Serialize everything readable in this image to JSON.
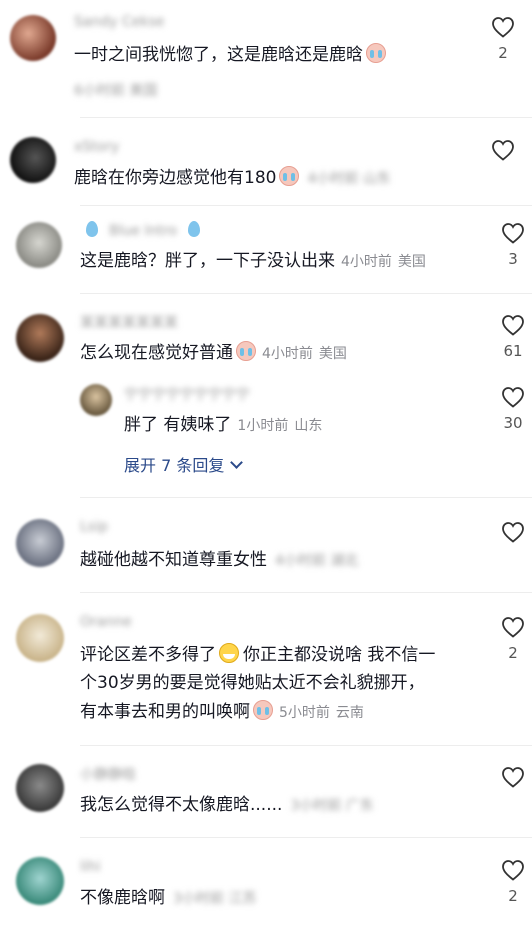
{
  "comments": [
    {
      "username": "Sandy Cekse",
      "text": "一时之间我恍惚了，这是鹿晗还是鹿晗",
      "meta_blurred": "6小时前 美国",
      "likes": "2"
    },
    {
      "username": "xStory",
      "text": "鹿晗在你旁边感觉他有180",
      "meta_blurred": "4小时前 山东",
      "likes": ""
    },
    {
      "username": "Blue Intro",
      "text": "这是鹿晗？胖了，一下子没认出来",
      "time": "4小时前",
      "location": "美国",
      "likes": "3"
    },
    {
      "username": "某某某某某某某",
      "text": "怎么现在感觉好普通",
      "time": "4小时前",
      "location": "美国",
      "likes": "61",
      "reply": {
        "username": "宁宁宁宁宁宁宁宁宁",
        "text": "胖了 有姨味了",
        "time": "1小时前",
        "location": "山东",
        "likes": "30"
      },
      "expand_label": "展开 7 条回复"
    },
    {
      "username": "Lsip",
      "text": "越碰他越不知道尊重女性",
      "meta_blurred": "4小时前 湖北",
      "likes": ""
    },
    {
      "username": "Oranne",
      "text_lines": [
        "评论区差不多得了",
        "你正主都没说啥 我不信一",
        "个30岁男的要是觉得她贴太近不会礼貌挪开，",
        "有本事去和男的叫唤啊"
      ],
      "time": "5小时前",
      "location": "云南",
      "likes": "2"
    },
    {
      "username": "小静静晗",
      "text": "我怎么觉得不太像鹿晗......",
      "meta_blurred": "3小时前 广东",
      "likes": ""
    },
    {
      "username": "lihi",
      "text": "不像鹿晗啊",
      "meta_blurred": "3小时前 江苏",
      "likes": "2"
    }
  ],
  "colors": {
    "text": "#161823",
    "meta": "#8a8b91",
    "link": "#2b4a8a",
    "background": "#ffffff"
  },
  "icons": {
    "like": "heart-outline-icon"
  }
}
